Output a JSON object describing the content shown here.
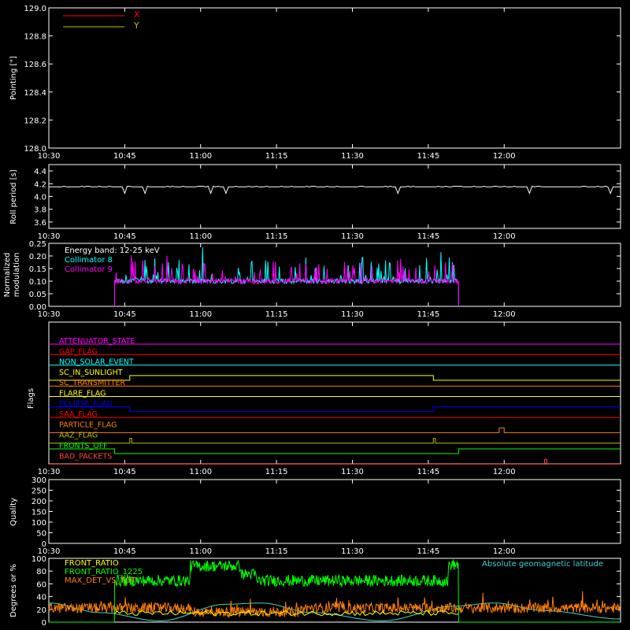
{
  "colors": {
    "background": "#000000",
    "axis": "#ffffff",
    "red": "#ff0000",
    "olive": "#c0c000",
    "white": "#ffffff",
    "cyan": "#00ffff",
    "magenta": "#ff00ff",
    "orange": "#ff8000",
    "yellow": "#ffff00",
    "blue": "#0000ff",
    "green": "#00ff00",
    "salmon": "#ff4040"
  },
  "time_ticks": [
    "10:30",
    "10:45",
    "11:00",
    "11:15",
    "11:30",
    "11:45",
    "12:00"
  ],
  "chart_data": [
    {
      "id": "pointing",
      "type": "line",
      "ylabel": "Pointing [\"]",
      "xlim": [
        "10:30",
        "12:23"
      ],
      "ylim": [
        128.0,
        129.0
      ],
      "yticks": [
        "128.0",
        "128.2",
        "128.4",
        "128.6",
        "128.8",
        "129.0"
      ],
      "series": [
        {
          "name": "X",
          "color": "#ff0000",
          "values": []
        },
        {
          "name": "Y",
          "color": "#c0c000",
          "values": []
        }
      ]
    },
    {
      "id": "roll",
      "type": "line",
      "ylabel": "Roll period [s]",
      "xlim": [
        "10:30",
        "12:23"
      ],
      "ylim": [
        3.5,
        4.5
      ],
      "yticks": [
        "3.6",
        "3.8",
        "4.0",
        "4.2",
        "4.4"
      ],
      "series": [
        {
          "color": "#ffffff",
          "level": 4.15,
          "dips": [
            "10:45",
            "10:49",
            "11:02",
            "11:05",
            "11:39",
            "12:05",
            "12:21"
          ],
          "dip_value": 4.05
        }
      ]
    },
    {
      "id": "modulation",
      "type": "line",
      "ylabel": "Normalized modulation",
      "xlim": [
        "10:30",
        "12:23"
      ],
      "ylim": [
        0.0,
        0.25
      ],
      "yticks": [
        "0.00",
        "0.05",
        "0.10",
        "0.15",
        "0.20",
        "0.25"
      ],
      "annotation": "Energy band: 12-25 keV",
      "active_range": [
        "10:43",
        "11:51"
      ],
      "series": [
        {
          "name": "Collimator 8",
          "color": "#00ffff",
          "level": 0.1
        },
        {
          "name": "Collimator 9",
          "color": "#ff00ff",
          "level": 0.1
        }
      ]
    },
    {
      "id": "flags",
      "type": "line",
      "ylabel": "Flags",
      "xlim": [
        "10:30",
        "12:23"
      ],
      "series": [
        {
          "name": "ATTENUATOR_STATE",
          "color": "#ff00ff",
          "high_ranges": []
        },
        {
          "name": "GAP_FLAG",
          "color": "#ff0000",
          "high_ranges": []
        },
        {
          "name": "NON_SOLAR_EVENT",
          "color": "#00ffff",
          "high_ranges": []
        },
        {
          "name": "SC_IN_SUNLIGHT",
          "color": "#ffff00",
          "high_ranges": [
            [
              "10:46",
              "11:46"
            ]
          ]
        },
        {
          "name": "SC_TRANSMITTER",
          "color": "#ff8000",
          "high_ranges": []
        },
        {
          "name": "FLARE_FLAG",
          "color": "#ffff00",
          "high_ranges": []
        },
        {
          "name": "ECLIPSE_FLAG",
          "color": "#0000ff",
          "high_ranges": [
            [
              "10:30",
              "10:46"
            ],
            [
              "11:46",
              "12:23"
            ]
          ]
        },
        {
          "name": "SAA_FLAG",
          "color": "#ff0000",
          "high_ranges": []
        },
        {
          "name": "PARTICLE_FLAG",
          "color": "#ff8000",
          "high_ranges": [
            [
              "11:59",
              "12:00"
            ]
          ]
        },
        {
          "name": "AAZ_FLAG",
          "color": "#c0c000",
          "high_ranges": [
            [
              "10:46",
              "10:46"
            ],
            [
              "11:46",
              "11:46"
            ]
          ]
        },
        {
          "name": "FRONTS_OFF",
          "color": "#00ff00",
          "high_ranges": [
            [
              "10:30",
              "10:43"
            ],
            [
              "11:51",
              "12:23"
            ]
          ]
        },
        {
          "name": "BAD_PACKETS",
          "color": "#ff4040",
          "high_ranges": [
            [
              "12:08",
              "12:08"
            ]
          ]
        }
      ]
    },
    {
      "id": "quality",
      "type": "line",
      "ylabel": "Quality",
      "xlim": [
        "10:30",
        "12:23"
      ],
      "ylim": [
        0,
        300
      ],
      "yticks": [
        "0",
        "50",
        "100",
        "150",
        "200",
        "250",
        "300"
      ],
      "series": []
    },
    {
      "id": "ratios",
      "type": "line",
      "ylabel": "Degrees or %",
      "xlim": [
        "10:30",
        "12:23"
      ],
      "ylim": [
        0,
        100
      ],
      "yticks": [
        "0",
        "20",
        "40",
        "60",
        "80",
        "100"
      ],
      "series": [
        {
          "name": "FRONT_RATIO",
          "color": "#ffff00"
        },
        {
          "name": "FRONT_RATIO_1225",
          "color": "#00ff00",
          "segments": [
            [
              "10:30",
              "10:43",
              0
            ],
            [
              "10:43",
              "10:58",
              65
            ],
            [
              "10:58",
              "11:08",
              88
            ],
            [
              "11:08",
              "11:11",
              75
            ],
            [
              "11:11",
              "11:49",
              65
            ],
            [
              "11:49",
              "11:51",
              90
            ],
            [
              "11:51",
              "12:23",
              0
            ]
          ]
        },
        {
          "name": "MAX_DET_VS_TOT",
          "color": "#ff8000",
          "level": 22
        },
        {
          "name": "Absolute geomagnetic latitude",
          "color": "#40d0d0",
          "curve": [
            [
              "10:30",
              30
            ],
            [
              "10:40",
              15
            ],
            [
              "10:52",
              2
            ],
            [
              "11:05",
              28
            ],
            [
              "11:12",
              30
            ],
            [
              "11:22",
              15
            ],
            [
              "11:36",
              2
            ],
            [
              "11:50",
              25
            ],
            [
              "11:58",
              30
            ],
            [
              "12:08",
              18
            ],
            [
              "12:23",
              5
            ]
          ]
        }
      ]
    }
  ]
}
